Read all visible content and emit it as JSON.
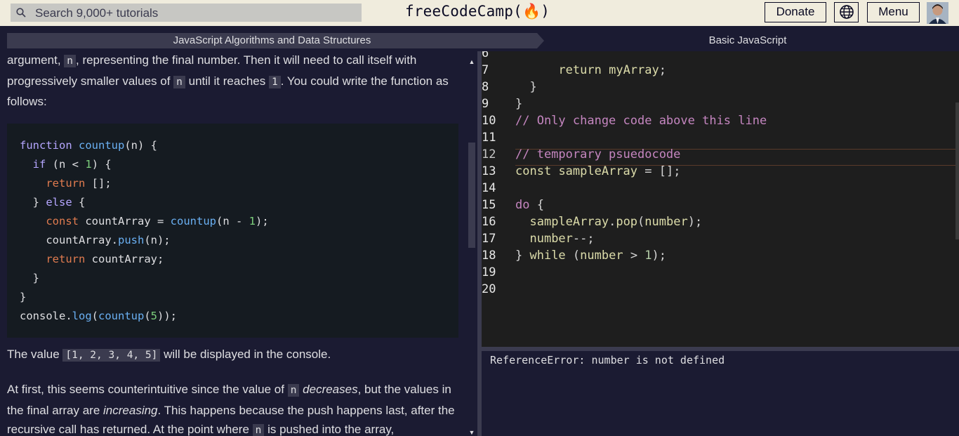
{
  "nav": {
    "search_placeholder": "Search 9,000+ tutorials",
    "brand": "freeCodeCamp(🔥)",
    "donate_label": "Donate",
    "menu_label": "Menu"
  },
  "breadcrumb": {
    "superblock": "JavaScript Algorithms and Data Structures",
    "block": "Basic JavaScript"
  },
  "instructions": {
    "p1_a": "argument, ",
    "p1_code1": "n",
    "p1_b": ", representing the final number. Then it will need to call itself with progressively smaller values of ",
    "p1_code2": "n",
    "p1_c": " until it reaches ",
    "p1_code3": "1",
    "p1_d": ". You could write the function as follows:",
    "code_lines": [
      "function countup(n) {",
      "  if (n < 1) {",
      "    return [];",
      "  } else {",
      "    const countArray = countup(n - 1);",
      "    countArray.push(n);",
      "    return countArray;",
      "  }",
      "}",
      "console.log(countup(5));"
    ],
    "p2_a": "The value ",
    "p2_code": "[1, 2, 3, 4, 5]",
    "p2_b": " will be displayed in the console.",
    "p3_a": "At first, this seems counterintuitive since the value of ",
    "p3_code": "n",
    "p3_em1": "decreases",
    "p3_b": ", but the values in the final array are ",
    "p3_em2": "increasing",
    "p3_c": ". This happens because the push happens last, after the recursive call has returned. At the point where ",
    "p3_code2": "n",
    "p3_d": " is pushed into the array,"
  },
  "editor": {
    "lines": [
      {
        "n": "6",
        "text": ""
      },
      {
        "n": "7",
        "text": "      return myArray;"
      },
      {
        "n": "8",
        "text": "  }"
      },
      {
        "n": "9",
        "text": "}"
      },
      {
        "n": "10",
        "text": "// Only change code above this line"
      },
      {
        "n": "11",
        "text": ""
      },
      {
        "n": "12",
        "text": "// temporary psuedocode"
      },
      {
        "n": "13",
        "text": "const sampleArray = [];"
      },
      {
        "n": "14",
        "text": ""
      },
      {
        "n": "15",
        "text": "do {"
      },
      {
        "n": "16",
        "text": "  sampleArray.pop(number);"
      },
      {
        "n": "17",
        "text": "  number--;"
      },
      {
        "n": "18",
        "text": "} while (number > 1);"
      },
      {
        "n": "19",
        "text": ""
      },
      {
        "n": "20",
        "text": ""
      }
    ]
  },
  "console": {
    "output": "ReferenceError: number is not defined"
  },
  "colors": {
    "nav_bg": "#f0ecdd",
    "panel_bg": "#1b1b32",
    "editor_bg": "#1e1e1e",
    "comment": "#c586c0"
  }
}
